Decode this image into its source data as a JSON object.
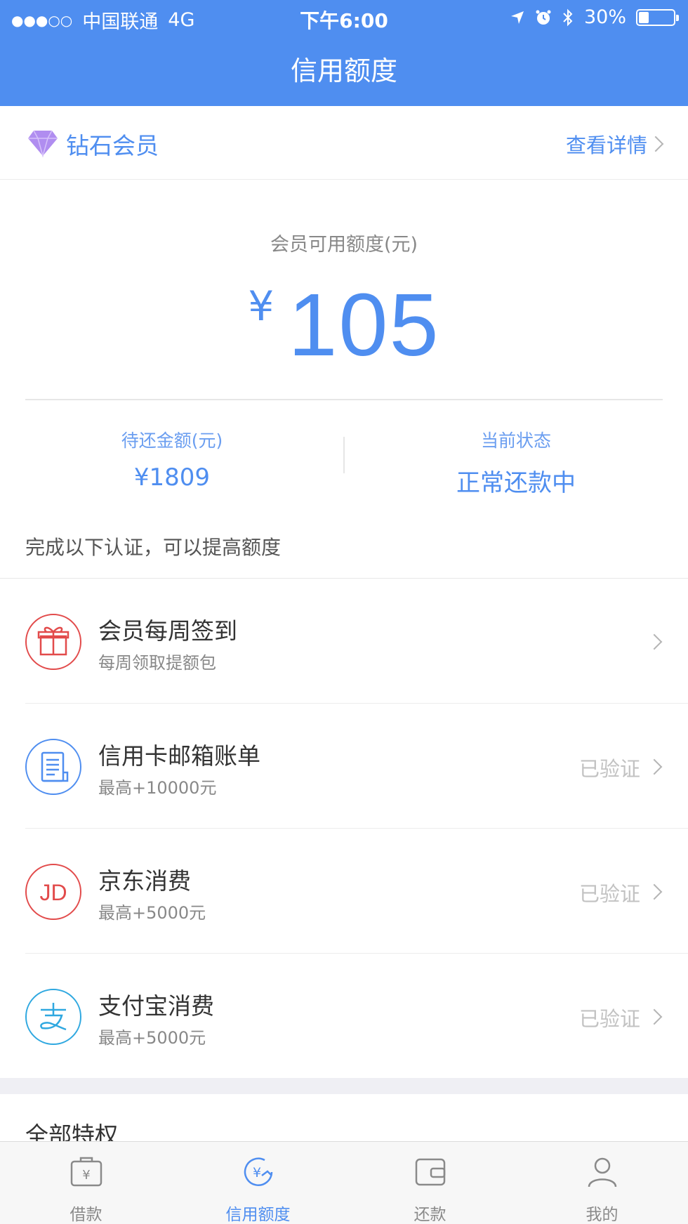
{
  "status_bar": {
    "carrier": "中国联通",
    "network": "4G",
    "time": "下午6:00",
    "battery": "30%",
    "battery_level": 0.3
  },
  "header": {
    "title": "信用额度"
  },
  "member": {
    "name": "钻石会员",
    "detail_link": "查看详情"
  },
  "quota": {
    "label": "会员可用额度(元)",
    "currency": "¥",
    "amount": "105"
  },
  "stats": [
    {
      "label": "待还金额(元)",
      "value": "¥1809"
    },
    {
      "label": "当前状态",
      "value": "正常还款中"
    }
  ],
  "hint": "完成以下认证，可以提高额度",
  "certifications": [
    {
      "title": "会员每周签到",
      "subtitle": "每周领取提额包",
      "status": "",
      "icon": "gift-icon",
      "color": "#e24b4b"
    },
    {
      "title": "信用卡邮箱账单",
      "subtitle": "最高+10000元",
      "status": "已验证",
      "icon": "bill-icon",
      "color": "#4f8ef0"
    },
    {
      "title": "京东消费",
      "subtitle": "最高+5000元",
      "status": "已验证",
      "icon": "jd-icon",
      "color": "#e24b4b"
    },
    {
      "title": "支付宝消费",
      "subtitle": "最高+5000元",
      "status": "已验证",
      "icon": "alipay-icon",
      "color": "#2fa8e0"
    }
  ],
  "privileges_title": "全部特权",
  "tabs": [
    {
      "label": "借款",
      "icon": "loan-icon"
    },
    {
      "label": "信用额度",
      "icon": "credit-icon",
      "active": true
    },
    {
      "label": "还款",
      "icon": "wallet-icon"
    },
    {
      "label": "我的",
      "icon": "user-icon"
    }
  ],
  "colors": {
    "primary": "#4f8ef0",
    "red": "#e24b4b",
    "cyan": "#2fa8e0"
  }
}
